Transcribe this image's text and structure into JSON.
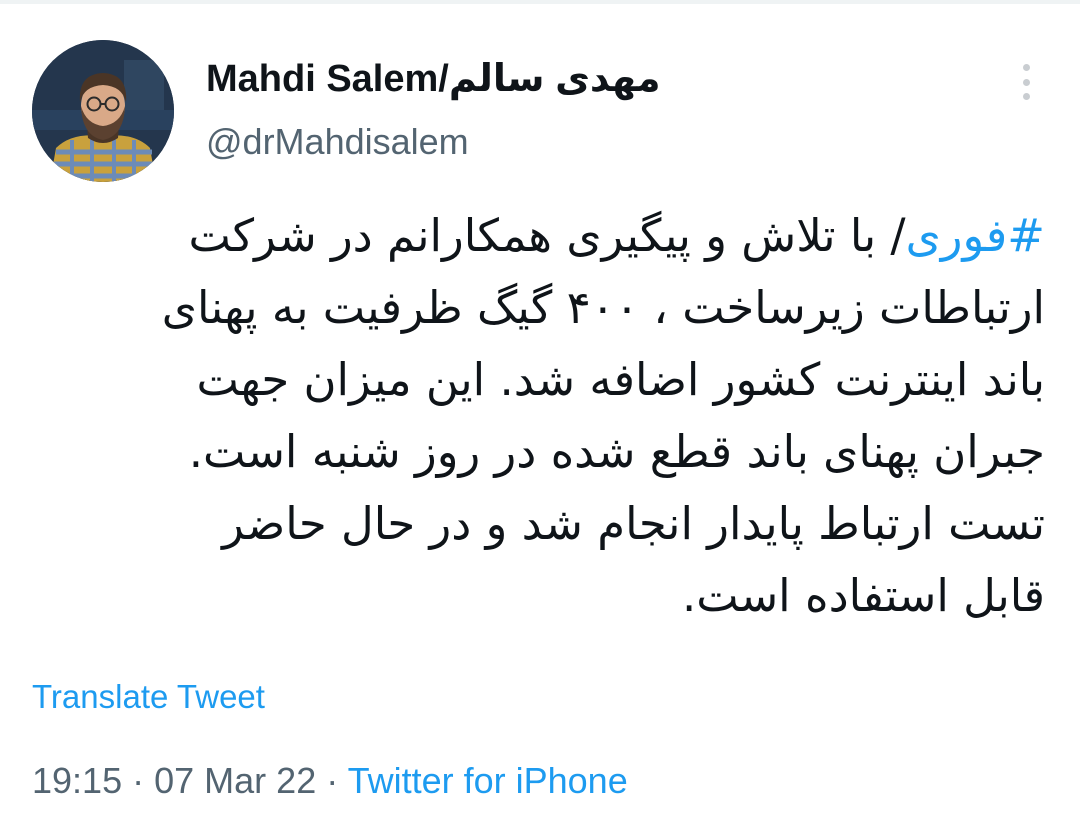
{
  "author": {
    "display_name": "Mahdi Salem/مهدی سالم",
    "handle": "@drMahdisalem",
    "avatar_icon": "avatar-photo"
  },
  "more_icon": "more-dots-vertical-icon",
  "tweet": {
    "hashtag": "#فوری",
    "lines": [
      "/ با تلاش و پیگیری همکارانم در شرکت",
      "ارتباطات زیرساخت ، ۴۰۰ گیگ ظرفیت به پهنای",
      "باند اینترنت کشور اضافه شد. این میزان جهت",
      "جبران پهنای باند قطع شده در روز شنبه است.",
      "تست ارتباط پایدار انجام شد و در حال حاضر",
      "قابل استفاده است."
    ]
  },
  "translate_label": "Translate Tweet",
  "meta": {
    "time": "19:15",
    "separator": "·",
    "date": "07 Mar 22",
    "source": "Twitter for iPhone"
  },
  "colors": {
    "text": "#0f1419",
    "secondary": "#536471",
    "accent": "#1d9bf0"
  }
}
